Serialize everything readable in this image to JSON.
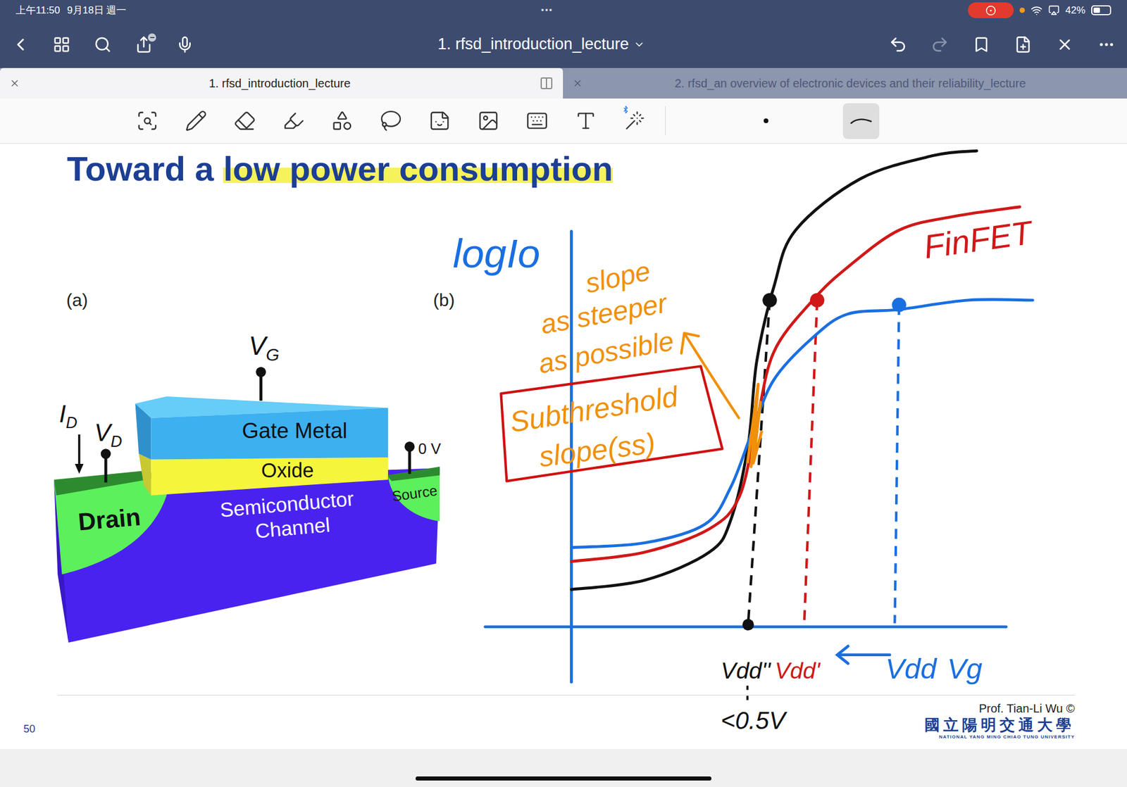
{
  "status_bar": {
    "time": "上午11:50",
    "date": "9月18日 週一",
    "more": "•••",
    "battery": "42%",
    "recording": true
  },
  "nav": {
    "title": "1. rfsd_introduction_lecture",
    "redo_disabled": true
  },
  "tabs": [
    {
      "label": "1. rfsd_introduction_lecture",
      "selected": true
    },
    {
      "label": "2. rfsd_an overview of electronic devices and their reliability_lecture",
      "selected": false
    }
  ],
  "toolbar": {
    "stroke_options": [
      {
        "kind": "dot",
        "selected": false
      },
      {
        "kind": "stroke",
        "selected": true
      }
    ]
  },
  "slide": {
    "title_plain": "Toward a ",
    "title_highlighted": "low power consumption",
    "panel_labels": [
      "(a)",
      "(b)"
    ],
    "diagram": {
      "gate": "Gate Metal",
      "oxide": "Oxide",
      "channel": [
        "Semiconductor",
        "Channel"
      ],
      "drain": "Drain",
      "source": "Source",
      "vg": {
        "main": "V",
        "sub": "G"
      },
      "id": {
        "main": "I",
        "sub": "D"
      },
      "vd": {
        "main": "V",
        "sub": "D"
      },
      "ground": "0 V"
    },
    "page_number": "50",
    "credit": "Prof. Tian-Li Wu ©",
    "university": "國立陽明交通大學",
    "university_en": "NATIONAL YANG MING CHIAO TUNG UNIVERSITY"
  },
  "ink": {
    "y_axis": "logIo",
    "x_axis": "Vg",
    "notes": [
      "slope",
      "as steeper",
      "as possible"
    ],
    "boxed": [
      "Subthreshold",
      "slope(ss)"
    ],
    "low_vdd_note": "<0.5V",
    "series": [
      {
        "name": "steepest",
        "color": "#111111",
        "vg": [
          0,
          17,
          32,
          37,
          41,
          43,
          47,
          52,
          67,
          84,
          94
        ],
        "logId": [
          8,
          10,
          16,
          23,
          39,
          57,
          73,
          85,
          96,
          101,
          102
        ],
        "marker": {
          "vg": 46,
          "logId": 70
        },
        "vdd": 41,
        "vdd_label": "Vdd''"
      },
      {
        "name": "finfet",
        "color": "#d01818",
        "label": "FinFET",
        "vg": [
          0,
          17,
          32,
          39,
          43,
          47,
          56,
          64,
          76,
          89,
          104
        ],
        "logId": [
          14,
          16,
          21,
          28,
          44,
          59,
          70,
          77,
          85,
          88,
          90
        ],
        "marker": {
          "vg": 57,
          "logId": 70
        },
        "vdd": 54,
        "vdd_label": "Vdd'"
      },
      {
        "name": "planar",
        "color": "#1a6fe0",
        "vg": [
          0,
          17,
          31,
          37,
          42,
          47,
          56,
          64,
          76,
          92,
          107
        ],
        "logId": [
          17,
          18,
          22,
          30,
          42,
          53,
          62,
          67,
          68,
          70,
          70
        ],
        "marker": {
          "vg": 76,
          "logId": 69
        },
        "vdd": 75,
        "vdd_label": "Vdd"
      }
    ]
  }
}
